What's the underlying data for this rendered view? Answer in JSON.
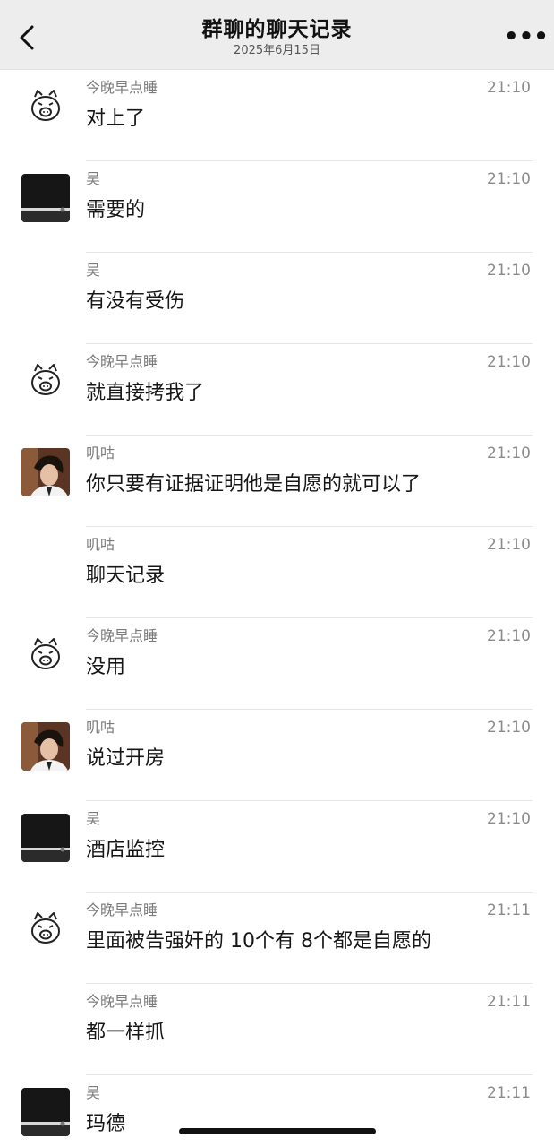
{
  "header": {
    "title": "群聊的聊天记录",
    "date": "2025年6月15日",
    "more_label": "•••",
    "back_icon": "chevron-left-icon"
  },
  "messages": [
    {
      "sender": "今晚早点睡",
      "time": "21:10",
      "text": "对上了",
      "avatar": "pig"
    },
    {
      "sender": "吴",
      "time": "21:10",
      "text": "需要的",
      "avatar": "dark"
    },
    {
      "sender": "吴",
      "time": "21:10",
      "text": "有没有受伤",
      "avatar": "none"
    },
    {
      "sender": "今晚早点睡",
      "time": "21:10",
      "text": "就直接拷我了",
      "avatar": "pig"
    },
    {
      "sender": "叽咕",
      "time": "21:10",
      "text": "你只要有证据证明他是自愿的就可以了",
      "avatar": "photo"
    },
    {
      "sender": "叽咕",
      "time": "21:10",
      "text": "聊天记录",
      "avatar": "none"
    },
    {
      "sender": "今晚早点睡",
      "time": "21:10",
      "text": "没用",
      "avatar": "pig"
    },
    {
      "sender": "叽咕",
      "time": "21:10",
      "text": "说过开房",
      "avatar": "photo"
    },
    {
      "sender": "吴",
      "time": "21:10",
      "text": "酒店监控",
      "avatar": "dark"
    },
    {
      "sender": "今晚早点睡",
      "time": "21:11",
      "text": "里面被告强奸的 10个有 8个都是自愿的",
      "avatar": "pig"
    },
    {
      "sender": "今晚早点睡",
      "time": "21:11",
      "text": "都一样抓",
      "avatar": "none"
    },
    {
      "sender": "吴",
      "time": "21:11",
      "text": "玛德",
      "avatar": "dark"
    }
  ]
}
